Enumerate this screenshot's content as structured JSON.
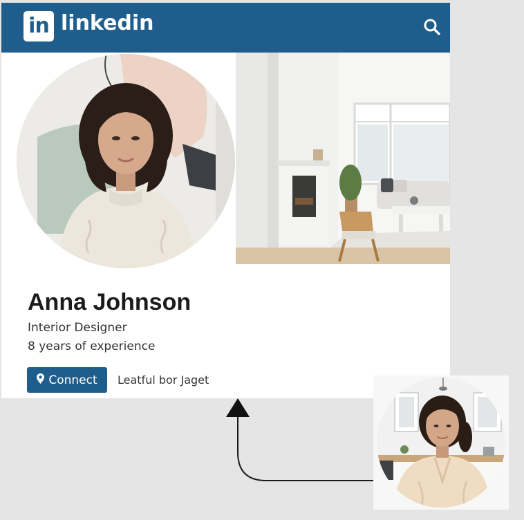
{
  "header": {
    "logo_mark": "in",
    "brand_name": "linkedin",
    "brand_color": "#1f5e8c",
    "search_icon": "search-icon"
  },
  "profile": {
    "name": "Anna Johnson",
    "headline": "Interior Designer",
    "experience": "8 years of experience",
    "connect_label": "Connect",
    "connect_icon": "location-pin-icon",
    "secondary_text": "Leatful bor Jaget"
  }
}
